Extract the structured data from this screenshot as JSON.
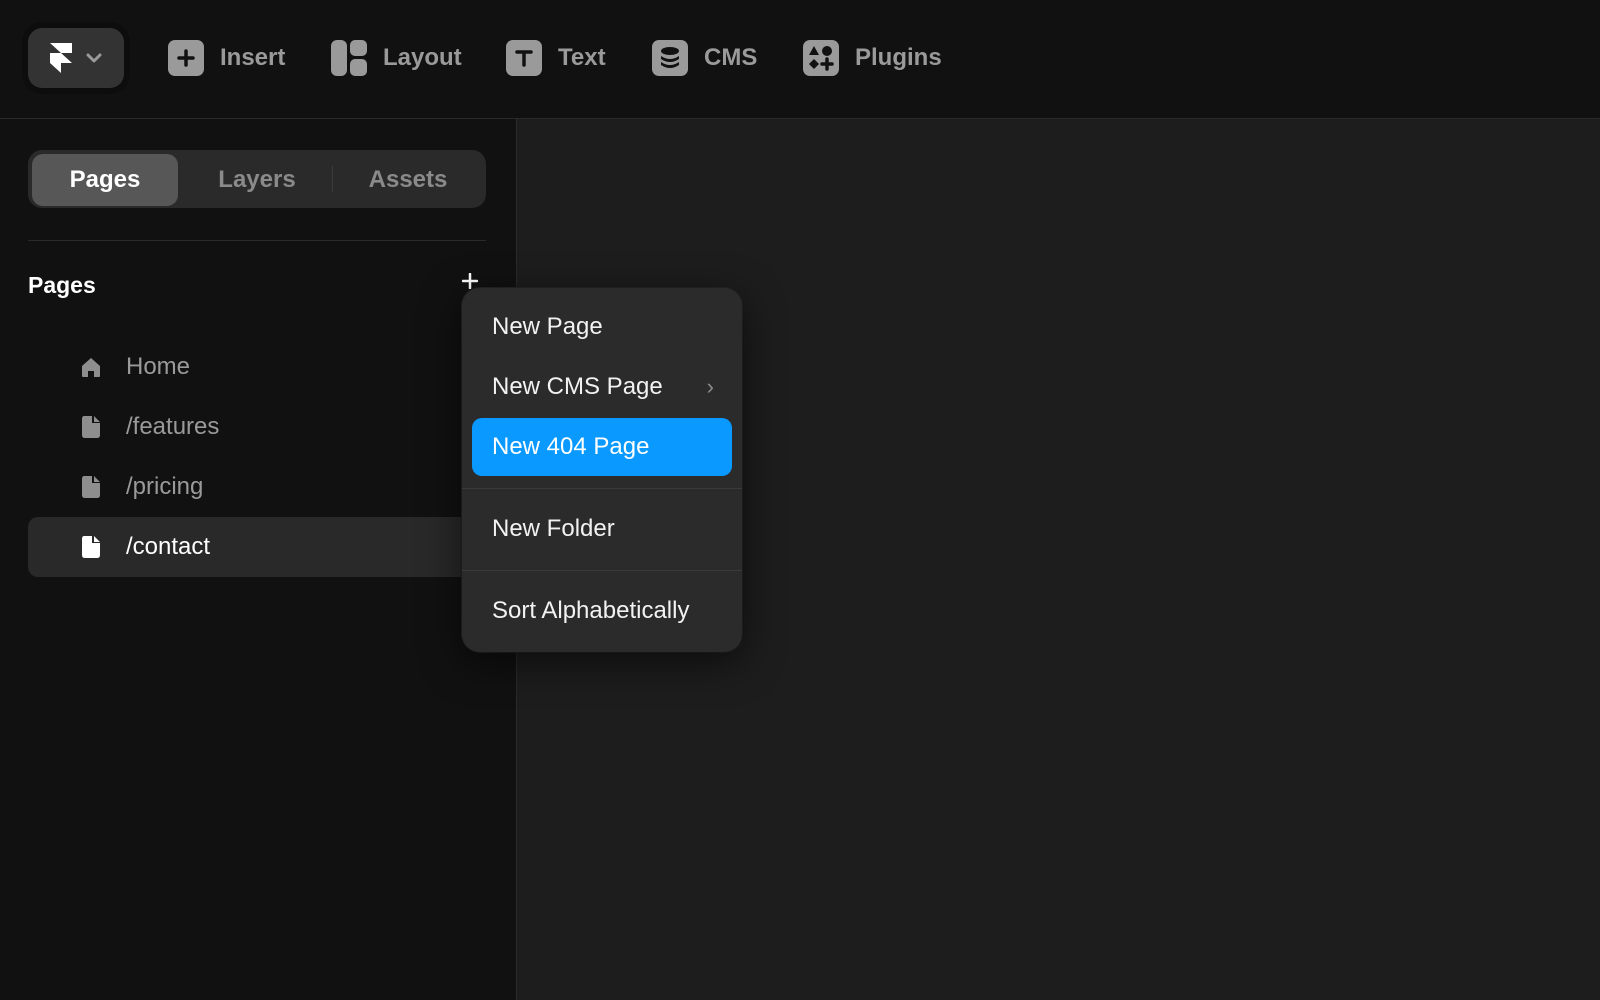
{
  "toolbar": {
    "items": [
      {
        "label": "Insert",
        "icon": "plus-square-icon"
      },
      {
        "label": "Layout",
        "icon": "layout-grid-icon"
      },
      {
        "label": "Text",
        "icon": "text-t-icon"
      },
      {
        "label": "CMS",
        "icon": "database-icon"
      },
      {
        "label": "Plugins",
        "icon": "shapes-icon"
      }
    ]
  },
  "sidebar": {
    "tabs": [
      {
        "label": "Pages",
        "active": true
      },
      {
        "label": "Layers",
        "active": false
      },
      {
        "label": "Assets",
        "active": false
      }
    ],
    "section_title": "Pages",
    "pages": [
      {
        "label": "Home",
        "icon": "home-icon",
        "selected": false
      },
      {
        "label": "/features",
        "icon": "page-icon",
        "selected": false
      },
      {
        "label": "/pricing",
        "icon": "page-icon",
        "selected": false
      },
      {
        "label": "/contact",
        "icon": "page-icon",
        "selected": true
      }
    ]
  },
  "context_menu": {
    "items": [
      {
        "label": "New Page"
      },
      {
        "label": "New CMS Page",
        "submenu": true
      },
      {
        "label": "New 404 Page",
        "highlighted": true
      },
      {
        "label": "New Folder"
      },
      {
        "label": "Sort Alphabetically"
      }
    ]
  },
  "colors": {
    "accent": "#0a99ff",
    "background": "#111111",
    "canvas": "#1d1d1d"
  }
}
